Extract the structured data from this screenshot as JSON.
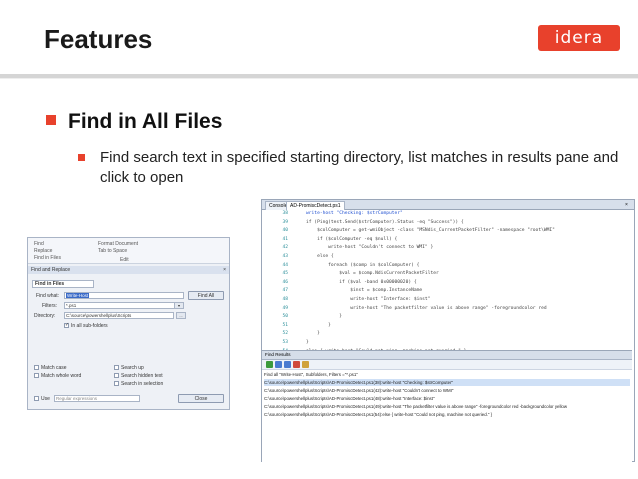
{
  "slide": {
    "title": "Features",
    "logo_text": "idera",
    "bullet": "Find in All Files",
    "sub_bullet": "Find search text in specified starting directory, list matches in results pane and click to open"
  },
  "dialog": {
    "ribbon": [
      "Find",
      "Replace",
      "Find in Files",
      "Format Document",
      "Tab to Space",
      "Edit"
    ],
    "title": "Find and Replace",
    "close": "×",
    "panel_title": "Find in Files",
    "find_what_label": "Find what:",
    "find_what_value": "Write-Host",
    "filters_label": "Filters:",
    "filters_value": "*.ps1",
    "directory_label": "Directory:",
    "directory_value": "C:\\source\\powershellplus\\Scripts",
    "browse": "...",
    "include_subfolders": "In all sub-folders",
    "find_all": "Find All",
    "match_case": "Match case",
    "match_whole_word": "Match whole word",
    "search_up": "Search up",
    "search_hidden_text": "Search hidden text",
    "search_in_selection": "Search in selection",
    "use_label": "Use",
    "use_value": "Regular expressions",
    "close_button": "Close"
  },
  "editor": {
    "tabs": [
      "Console",
      "AD-PromiscDetect.ps1",
      "×"
    ],
    "lines": [
      {
        "n": "38",
        "code": "write-host \"Checking: $strComputer\""
      },
      {
        "n": "39",
        "code": "if (Ping(test.Send($strComputer).Status -eq \"Success\")) {"
      },
      {
        "n": "40",
        "code": "    $colComputer = get-wmiObject -class \"MSNdis_CurrentPacketFilter\" -namespace \"root\\WMI\""
      },
      {
        "n": "41",
        "code": "    if ($colComputer -eq $null) {"
      },
      {
        "n": "42",
        "code": "        write-host \"Couldn't connect to WMI\" }"
      },
      {
        "n": "43",
        "code": "    else {"
      },
      {
        "n": "44",
        "code": "        foreach ($comp in $colComputer) {"
      },
      {
        "n": "45",
        "code": "            $val = $comp.NdisCurrentPacketFilter"
      },
      {
        "n": "46",
        "code": "            if ($val -band 0x00000020) {"
      },
      {
        "n": "47",
        "code": "                $inst = $comp.InstanceName"
      },
      {
        "n": "48",
        "code": "                write-host \"Interface: $inst\""
      },
      {
        "n": "49",
        "code": "                write-host \"The packetfilter value is above range\" -foregroundcolor red"
      },
      {
        "n": "50",
        "code": "            }"
      },
      {
        "n": "51",
        "code": "        }"
      },
      {
        "n": "52",
        "code": "    }"
      },
      {
        "n": "53",
        "code": "}"
      },
      {
        "n": "54",
        "code": "else { write-host \"Could not ping, machine not queried.\" }"
      },
      {
        "n": "55",
        "code": "}"
      }
    ],
    "error_list": "Error List"
  },
  "find_results": {
    "header": "Find Results",
    "summary": "Find all \"Write-Host\", Subfolders, Filters =\"*.ps1\"",
    "lines": [
      "C:\\source\\powershellplus\\Scripts\\AD-PromiscDetect.ps1(38):write-host \"Checking: $strComputer\"",
      "C:\\source\\powershellplus\\Scripts\\AD-PromiscDetect.ps1(42):write-host \"Couldn't connect to WMI\"",
      "C:\\source\\powershellplus\\Scripts\\AD-PromiscDetect.ps1(48):write-host \"Interface: $inst\"",
      "C:\\source\\powershellplus\\Scripts\\AD-PromiscDetect.ps1(49):write-host \"The packetfilter value is above range\" -foregroundcolor red -backgroundcolor yellow",
      "C:\\source\\powershellplus\\Scripts\\AD-PromiscDetect.ps1(54):else { write-host \"Could not ping, machine not queried.\" }"
    ]
  }
}
